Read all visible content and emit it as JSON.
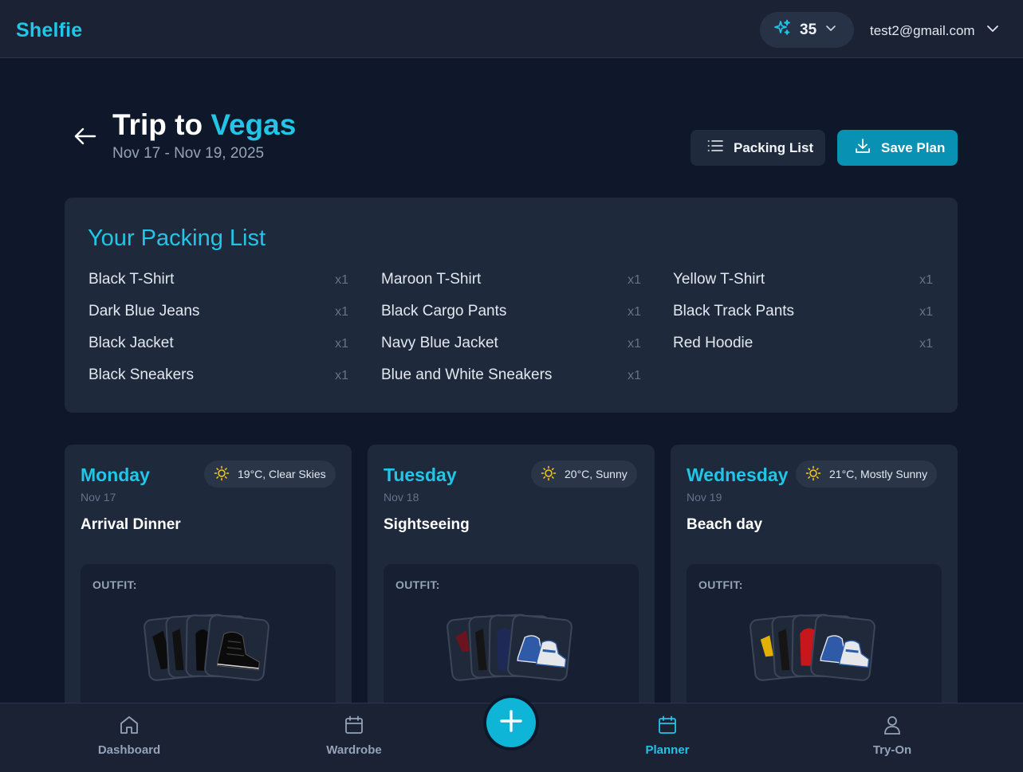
{
  "header": {
    "brand": "Shelfie",
    "credits": "35",
    "user_email": "test2@gmail.com"
  },
  "trip": {
    "title_prefix": "Trip to ",
    "title_accent": "Vegas",
    "dates": "Nov 17 - Nov 19, 2025",
    "packing_list_label": "Packing List",
    "save_label": "Save Plan"
  },
  "packing": {
    "heading": "Your Packing List",
    "columns": [
      [
        {
          "name": "Black T-Shirt",
          "qty": "x1"
        },
        {
          "name": "Dark Blue Jeans",
          "qty": "x1"
        },
        {
          "name": "Black Jacket",
          "qty": "x1"
        },
        {
          "name": "Black Sneakers",
          "qty": "x1"
        }
      ],
      [
        {
          "name": "Maroon T-Shirt",
          "qty": "x1"
        },
        {
          "name": "Black Cargo Pants",
          "qty": "x1"
        },
        {
          "name": "Navy Blue Jacket",
          "qty": "x1"
        },
        {
          "name": "Blue and White Sneakers",
          "qty": "x1"
        }
      ],
      [
        {
          "name": "Yellow T-Shirt",
          "qty": "x1"
        },
        {
          "name": "Black Track Pants",
          "qty": "x1"
        },
        {
          "name": "Red Hoodie",
          "qty": "x1"
        }
      ]
    ]
  },
  "days": [
    {
      "name": "Monday",
      "date": "Nov 17",
      "weather": "19°C, Clear Skies",
      "event": "Arrival Dinner",
      "outfit_label": "OUTFIT:"
    },
    {
      "name": "Tuesday",
      "date": "Nov 18",
      "weather": "20°C, Sunny",
      "event": "Sightseeing",
      "outfit_label": "OUTFIT:"
    },
    {
      "name": "Wednesday",
      "date": "Nov 19",
      "weather": "21°C, Mostly Sunny",
      "event": "Beach day",
      "outfit_label": "OUTFIT:"
    }
  ],
  "nav": {
    "dashboard": "Dashboard",
    "wardrobe": "Wardrobe",
    "planner": "Planner",
    "tryon": "Try-On"
  },
  "colors": {
    "accent": "#22c5e6",
    "background": "#0f172a",
    "card": "#1e293b",
    "save_button": "#0891b2"
  }
}
